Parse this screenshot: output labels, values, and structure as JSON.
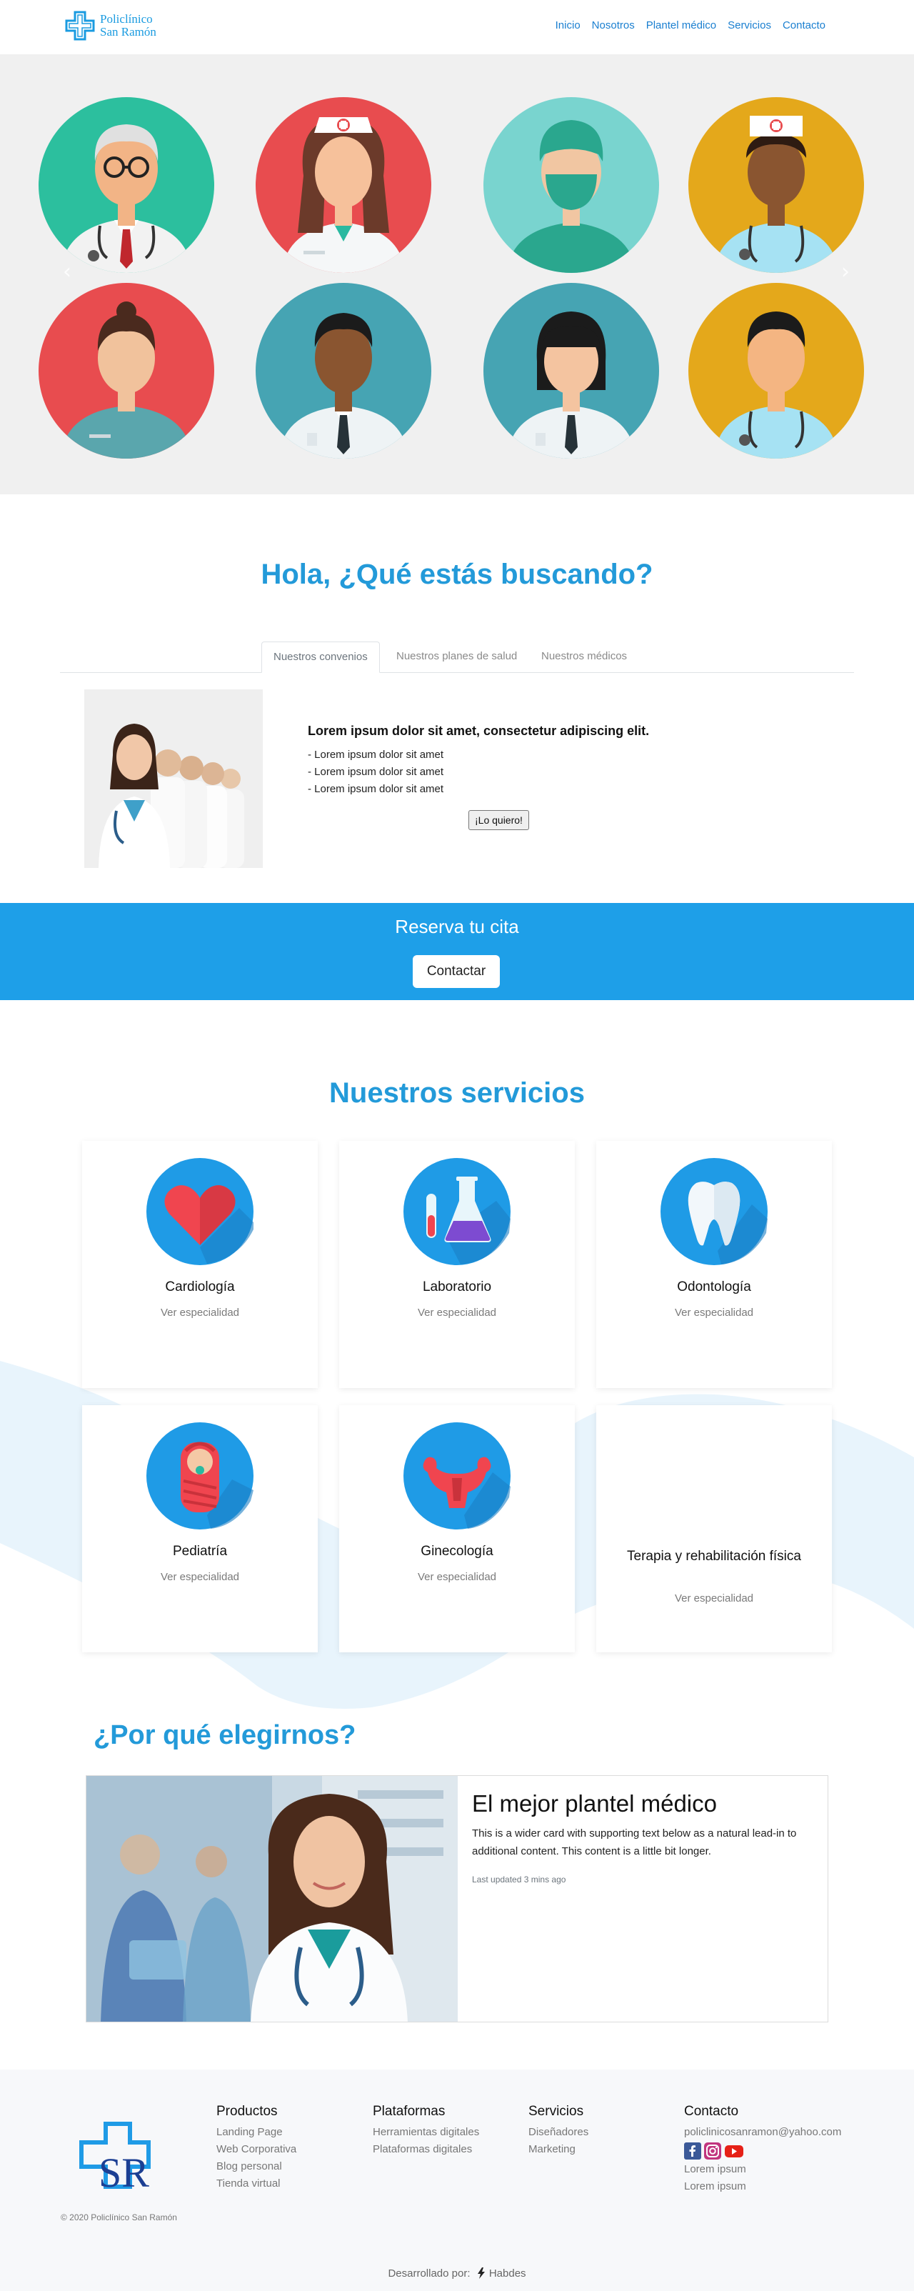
{
  "brand": {
    "name_line1": "Policlínico",
    "name_line2": "San Ramón",
    "color": "#1a9be0"
  },
  "nav": {
    "items": [
      "Inicio",
      "Nosotros",
      "Plantel médico",
      "Servicios",
      "Contacto"
    ]
  },
  "hero": {
    "type": "carousel",
    "prev_icon": "chevron-left-icon",
    "next_icon": "chevron-right-icon",
    "prev_glyph": "‹",
    "next_glyph": "›"
  },
  "search": {
    "title": "Hola, ¿Qué estás buscando?",
    "tabs": [
      "Nuestros convenios",
      "Nuestros planes de salud",
      "Nuestros médicos"
    ],
    "active_tab": "Nuestros convenios",
    "panel": {
      "heading": "Lorem ipsum dolor sit amet, consectetur adipiscing elit.",
      "items": [
        "- Lorem ipsum dolor sit amet",
        "- Lorem ipsum dolor sit amet",
        "- Lorem ipsum dolor sit amet"
      ],
      "button": "¡Lo quiero!"
    }
  },
  "cta": {
    "title": "Reserva tu cita",
    "button": "Contactar",
    "color": "#1e9fe8"
  },
  "services": {
    "title": "Nuestros servicios",
    "cards": [
      {
        "title": "Cardiología",
        "link": "Ver especialidad",
        "icon": "heart-icon"
      },
      {
        "title": "Laboratorio",
        "link": "Ver especialidad",
        "icon": "flask-icon"
      },
      {
        "title": "Odontología",
        "link": "Ver especialidad",
        "icon": "tooth-icon"
      },
      {
        "title": "Pediatría",
        "link": "Ver especialidad",
        "icon": "baby-icon"
      },
      {
        "title": "Ginecología",
        "link": "Ver especialidad",
        "icon": "uterus-icon"
      },
      {
        "title": "Terapia y rehabilitación física",
        "link": "Ver especialidad",
        "icon": ""
      }
    ]
  },
  "why": {
    "title": "¿Por qué elegirnos?",
    "card_title": "El mejor plantel médico",
    "card_text": "This is a wider card with supporting text below as a natural lead-in to additional content. This content is a little bit longer.",
    "card_time": "Last updated 3 mins ago"
  },
  "footer": {
    "copyright": "© 2020 Policlínico San Ramón",
    "logo_letters": "SR",
    "columns": [
      {
        "title": "Productos",
        "items": [
          "Landing Page",
          "Web Corporativa",
          "Blog personal",
          "Tienda virtual"
        ]
      },
      {
        "title": "Plataformas",
        "items": [
          "Herramientas digitales",
          "Plataformas digitales"
        ]
      },
      {
        "title": "Servicios",
        "items": [
          "Diseñadores",
          "Marketing"
        ]
      }
    ],
    "contact": {
      "title": "Contacto",
      "email": "policlinicosanramon@yahoo.com",
      "social": [
        "facebook-icon",
        "instagram-icon",
        "youtube-icon"
      ],
      "lines": [
        "Lorem ipsum",
        "Lorem ipsum"
      ]
    },
    "dev_label": "Desarrollado por:",
    "dev_name": "Habdes"
  }
}
